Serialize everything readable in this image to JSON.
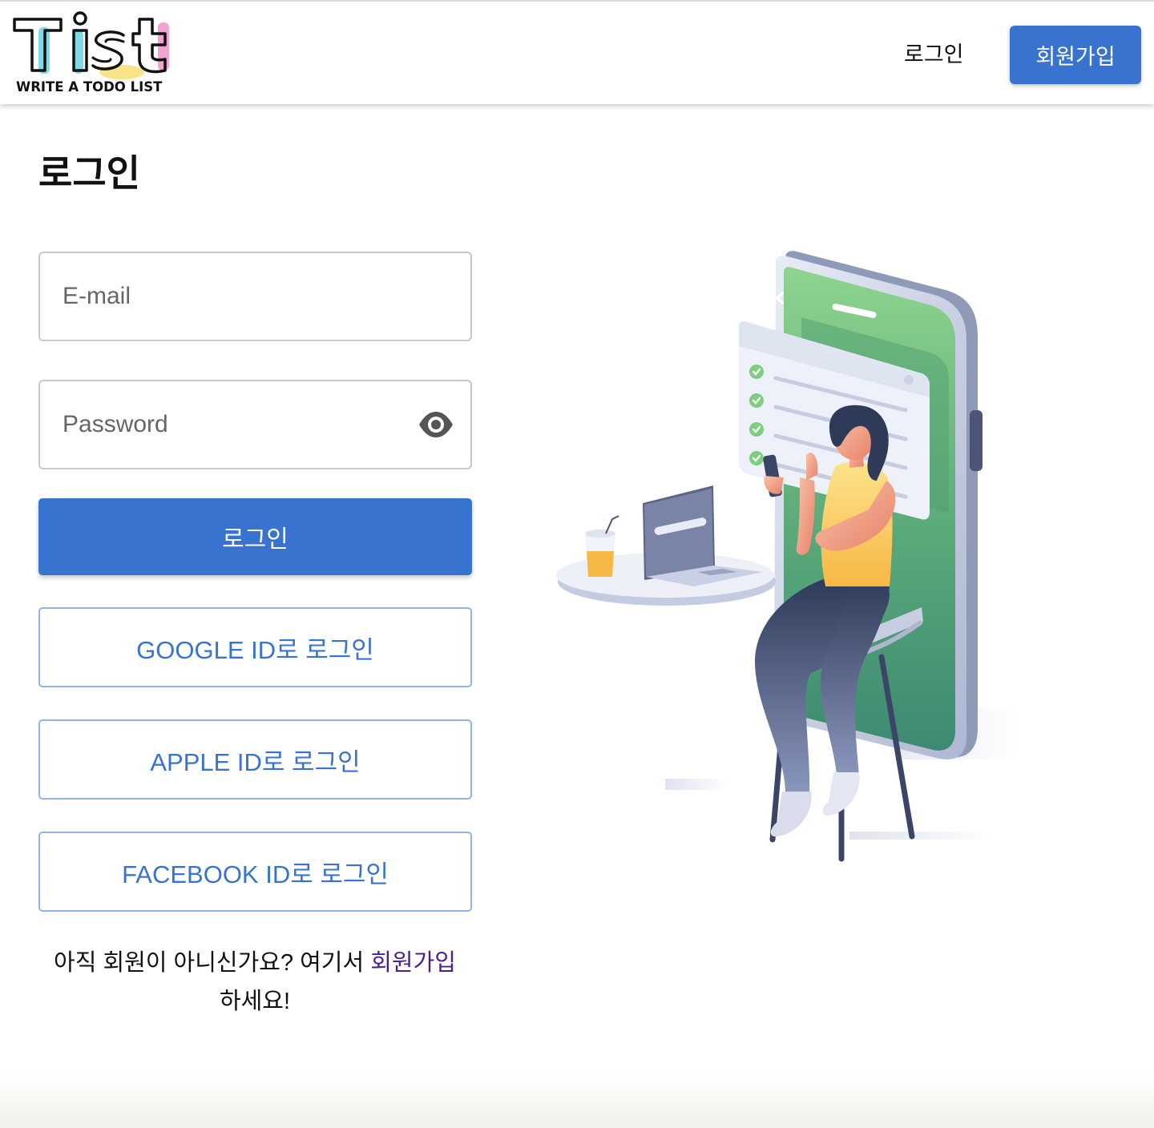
{
  "header": {
    "logo_text": "Tist",
    "logo_caption": "WRITE A TODO LIST",
    "login_label": "로그인",
    "signup_label": "회원가입"
  },
  "main": {
    "title": "로그인",
    "email_placeholder": "E-mail",
    "password_placeholder": "Password",
    "login_button": "로그인",
    "google_button": "GOOGLE ID로 로그인",
    "apple_button": "APPLE ID로 로그인",
    "facebook_button": "FACEBOOK ID로 로그인",
    "signup_prompt": "아직 회원이 아니신가요? 여기서 ",
    "signup_link": "회원가입",
    "signup_suffix": "하세요!"
  },
  "icons": {
    "password_toggle": "eye-icon",
    "illustration": "woman-using-phone-illustration"
  },
  "colors": {
    "primary": "#3874cf",
    "outline_border": "#93b1e4",
    "link_visited": "#4b1f8f",
    "logo_cyan": "#7fd9e6",
    "logo_yellow": "#fbe38a",
    "logo_pink": "#f2a3cf",
    "phone_green": "#5fb477"
  }
}
